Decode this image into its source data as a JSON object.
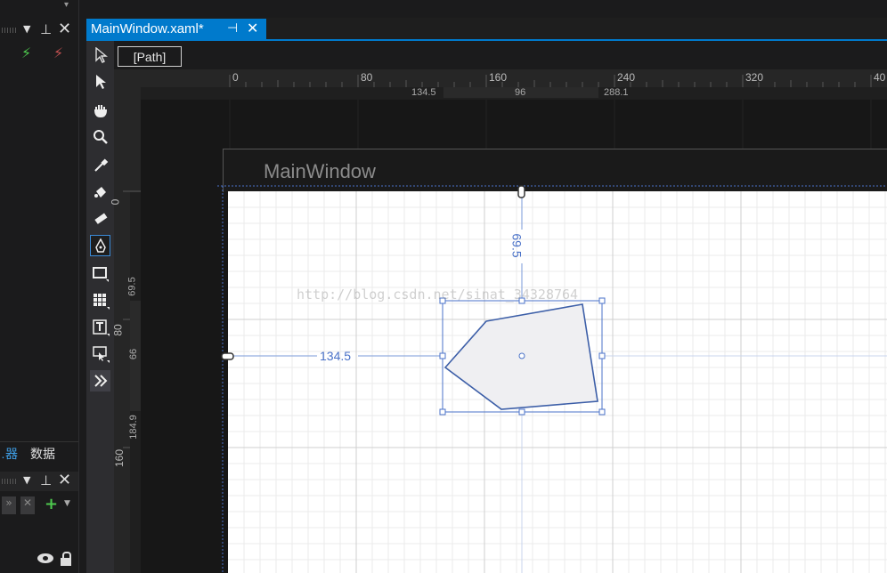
{
  "document": {
    "tab_title": "MainWindow.xaml*",
    "breadcrumb": "[Path]",
    "window_title": "MainWindow",
    "watermark": "http://blog.csdn.net/sinat_34328764"
  },
  "left_panel": {
    "tab_active": "…器",
    "tab_data": "数据"
  },
  "ruler_top": {
    "ticks": [
      "0",
      "80",
      "160",
      "240",
      "320",
      "40"
    ],
    "measures": [
      "134.5",
      "96",
      "288.1"
    ]
  },
  "ruler_left": {
    "ticks": [
      "0",
      "80",
      "160"
    ],
    "measures": [
      "69.5",
      "66",
      "184.9"
    ]
  },
  "annotations": {
    "left_distance": "134.5",
    "top_distance": "69.5"
  },
  "colors": {
    "accent": "#007acc",
    "selection": "#4a72c8",
    "canvas": "#ffffff",
    "shape_fill": "#efeff2"
  },
  "tools": [
    "selection-arrow",
    "direct-selection",
    "pan-hand",
    "zoom",
    "eyedropper",
    "paint-bucket",
    "eraser",
    "pen",
    "rectangle",
    "grid",
    "text",
    "control",
    "more"
  ]
}
